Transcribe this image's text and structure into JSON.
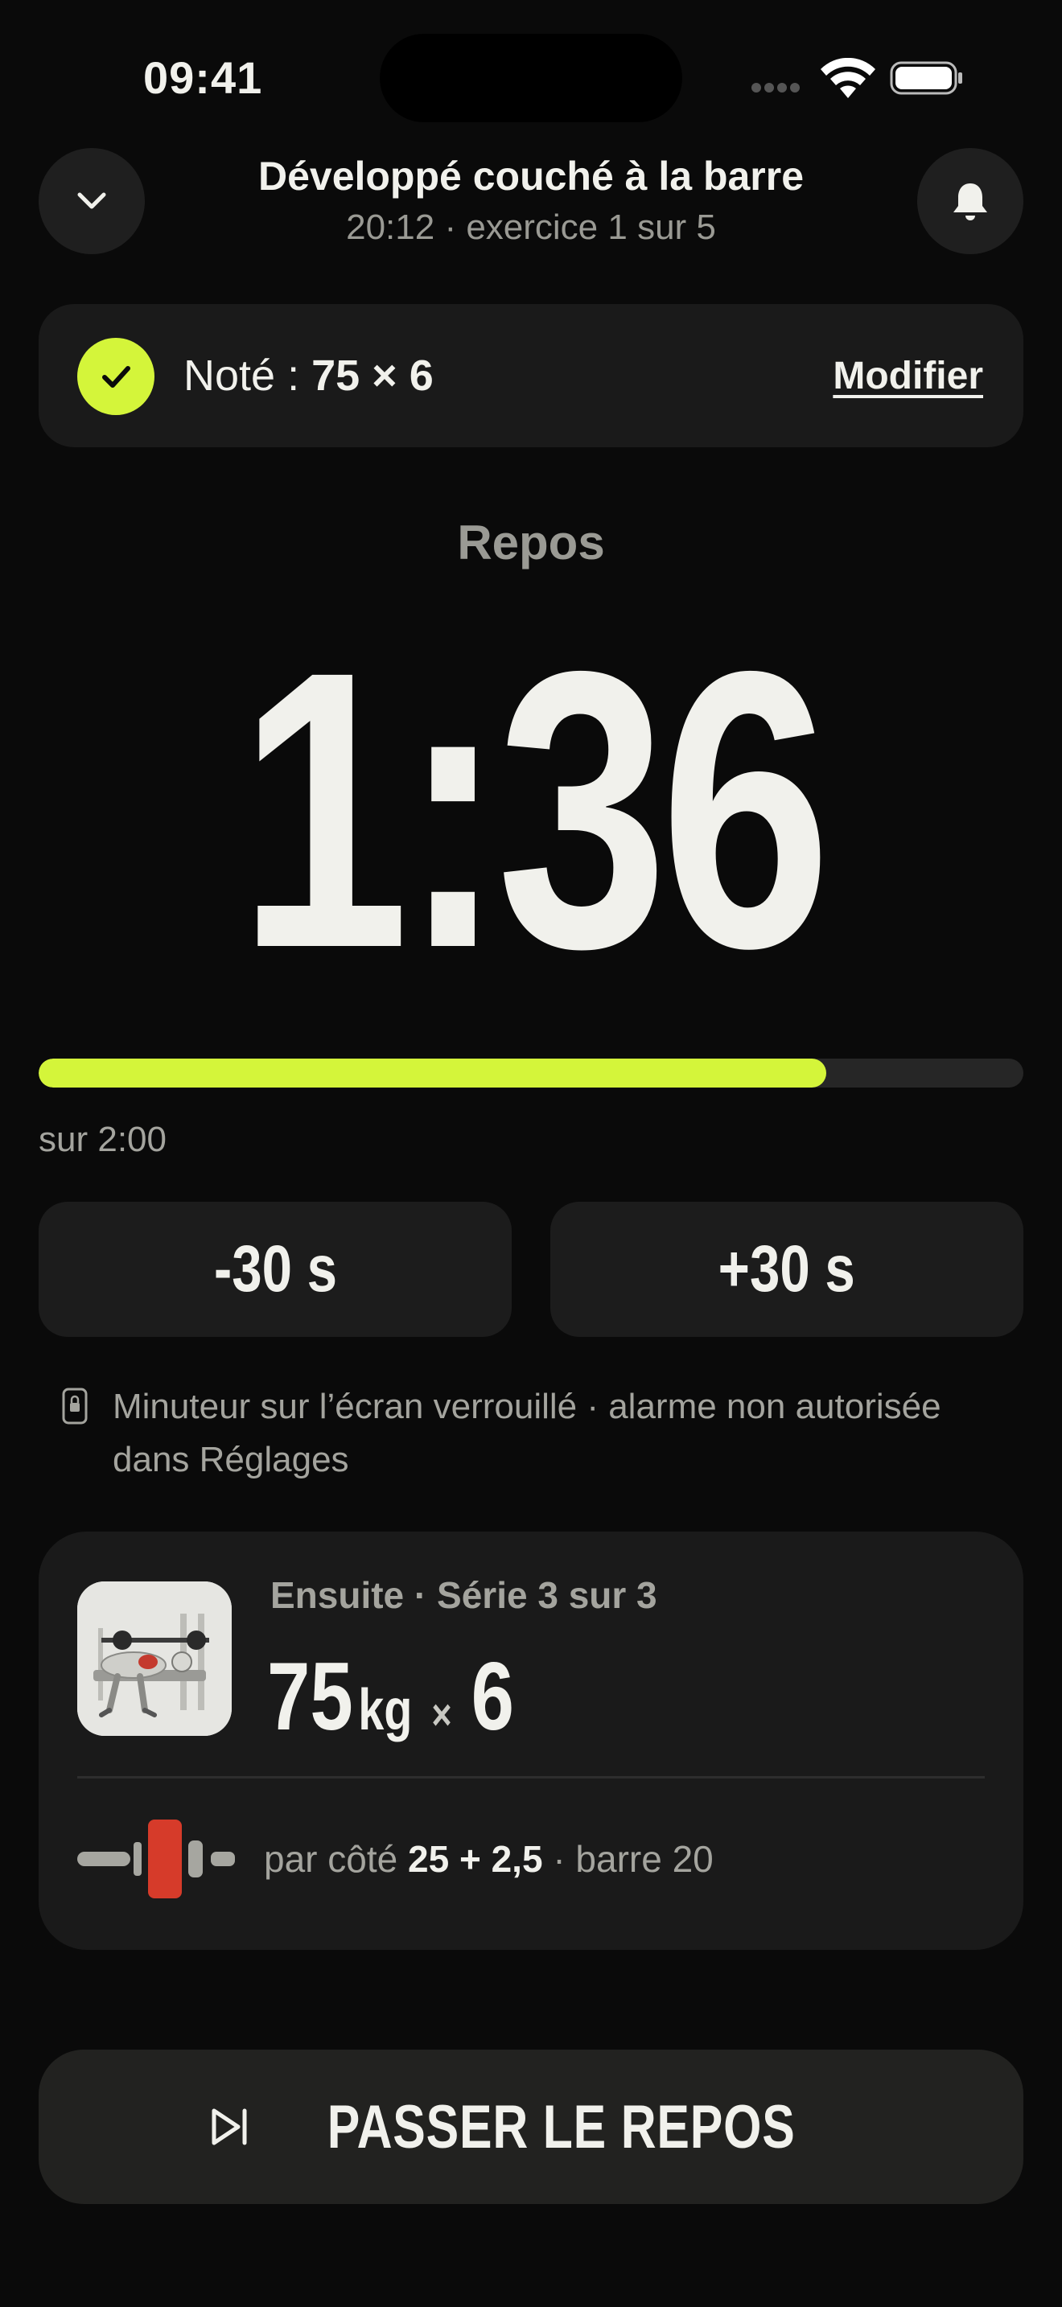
{
  "status_bar": {
    "time": "09:41"
  },
  "header": {
    "title": "Développé couché à la barre",
    "elapsed": "20:12",
    "exercise_progress": "· exercice 1 sur 5",
    "collapse_icon": "chevron-down-icon",
    "alert_icon": "bell-icon"
  },
  "logged": {
    "label": "Noté :",
    "value": "75 × 6",
    "edit_label": "Modifier",
    "icon": "check-icon"
  },
  "rest": {
    "label": "Repos",
    "remaining": "1:36",
    "total_label": "sur 2:00",
    "progress": 0.8,
    "minus_label": "-30 s",
    "plus_label": "+30 s"
  },
  "lock_note": {
    "text": "Minuteur sur l’écran verrouillé · alarme non autorisée dans Réglages",
    "icon": "lock-icon"
  },
  "next": {
    "label": "Ensuite · Série 3 sur 3",
    "weight": "75",
    "unit": "kg",
    "times": "×",
    "reps": "6",
    "plates_prefix": "par côté",
    "plates_value": "25 + 2,5",
    "plates_suffix": "· barre 20",
    "thumb_icon": "bench-press-illustration",
    "plates_icon": "barbell-plates-icon"
  },
  "skip": {
    "label": "PASSER LE REPOS",
    "icon": "skip-forward-icon"
  },
  "colors": {
    "background": "#0a0a0a",
    "accent": "#d4f53a",
    "card": "#1a1a1a",
    "plate_red": "#d63b2a"
  }
}
